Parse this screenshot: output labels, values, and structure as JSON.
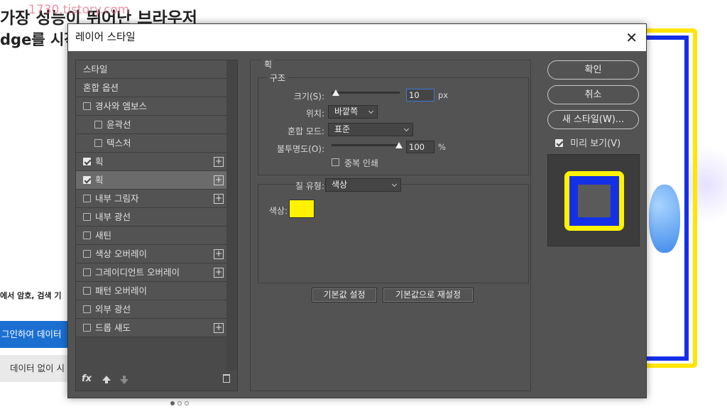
{
  "background": {
    "headline1": "가장 성능이 뛰어난 브라우저",
    "watermark": "1730.tistory.com",
    "headline2": "dge를 시작",
    "body_text": "에서 암호, 검색 기",
    "primary_button": "그인하여 데이터",
    "secondary_button": "데이터 없이 시"
  },
  "dialog": {
    "title": "레이어 스타일",
    "close_glyph": "✕",
    "styles_list": [
      {
        "label": "스타일",
        "checkbox": false,
        "checked": false,
        "plus": false,
        "sub": false,
        "selected": false
      },
      {
        "label": "혼합 옵션",
        "checkbox": false,
        "checked": false,
        "plus": false,
        "sub": false,
        "selected": false
      },
      {
        "label": "경사와 엠보스",
        "checkbox": true,
        "checked": false,
        "plus": false,
        "sub": false,
        "selected": false
      },
      {
        "label": "윤곽선",
        "checkbox": true,
        "checked": false,
        "plus": false,
        "sub": true,
        "selected": false
      },
      {
        "label": "텍스처",
        "checkbox": true,
        "checked": false,
        "plus": false,
        "sub": true,
        "selected": false
      },
      {
        "label": "획",
        "checkbox": true,
        "checked": true,
        "plus": true,
        "sub": false,
        "selected": false
      },
      {
        "label": "획",
        "checkbox": true,
        "checked": true,
        "plus": true,
        "sub": false,
        "selected": true
      },
      {
        "label": "내부 그림자",
        "checkbox": true,
        "checked": false,
        "plus": true,
        "sub": false,
        "selected": false
      },
      {
        "label": "내부 광선",
        "checkbox": true,
        "checked": false,
        "plus": false,
        "sub": false,
        "selected": false
      },
      {
        "label": "새틴",
        "checkbox": true,
        "checked": false,
        "plus": false,
        "sub": false,
        "selected": false
      },
      {
        "label": "색상 오버레이",
        "checkbox": true,
        "checked": false,
        "plus": true,
        "sub": false,
        "selected": false
      },
      {
        "label": "그레이디언트 오버레이",
        "checkbox": true,
        "checked": false,
        "plus": true,
        "sub": false,
        "selected": false
      },
      {
        "label": "패턴 오버레이",
        "checkbox": true,
        "checked": false,
        "plus": false,
        "sub": false,
        "selected": false
      },
      {
        "label": "외부 광선",
        "checkbox": true,
        "checked": false,
        "plus": false,
        "sub": false,
        "selected": false
      },
      {
        "label": "드롭 섀도",
        "checkbox": true,
        "checked": false,
        "plus": true,
        "sub": false,
        "selected": false
      }
    ],
    "footer": {
      "fx_label": "fx"
    },
    "stroke": {
      "section_title": "획",
      "structure_title": "구조",
      "size_label": "크기(S):",
      "size_value": "10",
      "size_unit": "px",
      "size_slider_fraction": 0.05,
      "position_label": "위치:",
      "position_value": "바깥쪽",
      "blend_label": "혼합 모드:",
      "blend_value": "표준",
      "opacity_label": "불투명도(O):",
      "opacity_value": "100",
      "opacity_unit": "%",
      "opacity_slider_fraction": 1.0,
      "overprint_label": "중복 인쇄",
      "fill_type_label": "칠 유형:",
      "fill_type_value": "색상",
      "color_label": "색상:",
      "color_hex": "#fff200",
      "make_default_label": "기본값 설정",
      "reset_default_label": "기본값으로 재설정"
    },
    "buttons": {
      "ok": "확인",
      "cancel": "취소",
      "new_style": "새 스타일(W)..."
    },
    "preview_label": "미리 보기(V)"
  },
  "colors": {
    "stroke_yellow": "#fff200",
    "stroke_blue": "#1430e6",
    "dialog_bg": "#535353",
    "accent_blue": "#1b6fd1"
  }
}
